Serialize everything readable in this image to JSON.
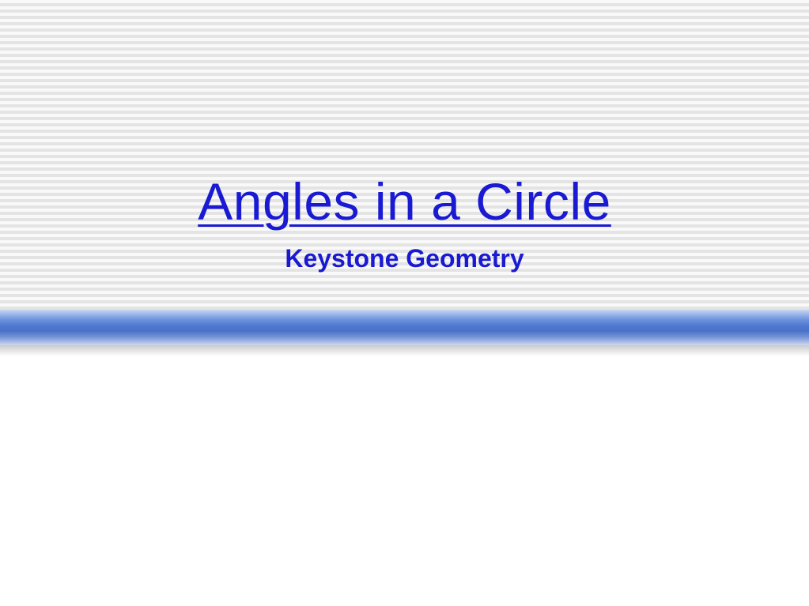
{
  "slide": {
    "title": "Angles in a Circle",
    "subtitle": "Keystone Geometry"
  },
  "colors": {
    "title_text": "#1a1ad2",
    "band_blue": "#4a72c8",
    "stripe_light": "#f9f9f9",
    "stripe_dark": "#e4e4e4"
  }
}
